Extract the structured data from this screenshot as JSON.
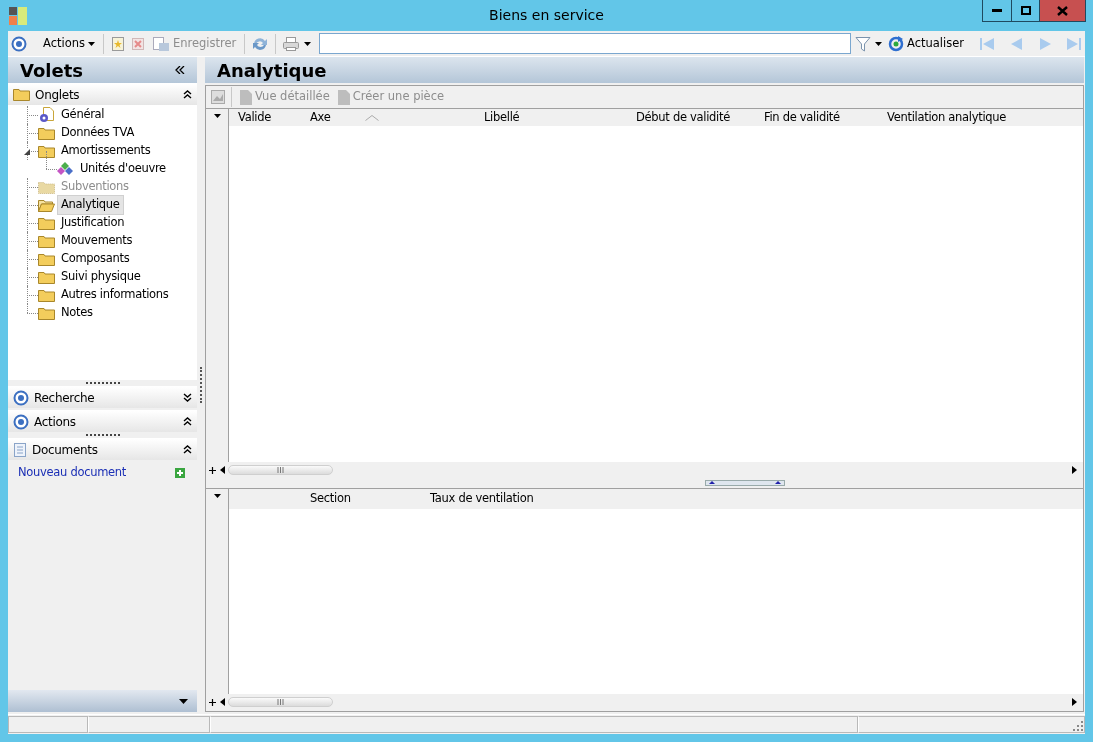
{
  "window": {
    "title": "Biens en service"
  },
  "toolbar": {
    "actions_menu": {
      "label": "Actions"
    },
    "save": {
      "label": "Enregistrer",
      "disabled": true
    },
    "refresh": {
      "label": "Actualiser",
      "disabled": false
    }
  },
  "sidebar": {
    "title": "Volets",
    "sections": [
      {
        "kind": "tree",
        "title": "Onglets",
        "expanded": true,
        "items": [
          {
            "kind": "page",
            "label": "Général",
            "selected": false,
            "disabled": false
          },
          {
            "kind": "folder",
            "label": "Données TVA",
            "selected": false,
            "disabled": false
          },
          {
            "kind": "folder",
            "label": "Amortissements",
            "selected": false,
            "disabled": false,
            "expanded": true,
            "children": [
              {
                "kind": "component",
                "label": "Unités d'oeuvre",
                "selected": false,
                "disabled": false
              }
            ]
          },
          {
            "kind": "folder",
            "label": "Subventions",
            "selected": false,
            "disabled": true
          },
          {
            "kind": "folder",
            "label": "Analytique",
            "selected": true,
            "disabled": false
          },
          {
            "kind": "folder",
            "label": "Justification",
            "selected": false,
            "disabled": false
          },
          {
            "kind": "folder",
            "label": "Mouvements",
            "selected": false,
            "disabled": false
          },
          {
            "kind": "folder",
            "label": "Composants",
            "selected": false,
            "disabled": false
          },
          {
            "kind": "folder",
            "label": "Suivi physique",
            "selected": false,
            "disabled": false
          },
          {
            "kind": "folder",
            "label": "Autres informations",
            "selected": false,
            "disabled": false
          },
          {
            "kind": "folder",
            "label": "Notes",
            "selected": false,
            "disabled": false
          }
        ]
      },
      {
        "kind": "task",
        "title": "Recherche",
        "expanded": false
      },
      {
        "kind": "task",
        "title": "Actions",
        "expanded": true
      },
      {
        "kind": "links",
        "title": "Documents",
        "expanded": true,
        "links": [
          "Nouveau document"
        ]
      }
    ]
  },
  "main": {
    "title": "Analytique",
    "subtoolbar": {
      "detail_view": {
        "label": "Vue détaillée",
        "disabled": true
      },
      "create_piece": {
        "label": "Créer une pièce",
        "disabled": true
      }
    },
    "grid": {
      "columns": [
        {
          "label": "Valide",
          "sorted": false
        },
        {
          "label": "Axe",
          "sorted": false
        },
        {
          "sorted": true
        },
        {
          "label": "Libellé",
          "sorted": false
        },
        {
          "label": "Début de validité",
          "sorted": false
        },
        {
          "label": "Fin de validité",
          "sorted": false
        },
        {
          "label": "Ventilation analytique",
          "sorted": false
        }
      ]
    },
    "detail_grid": {
      "columns": [
        {
          "label": "Section"
        },
        {
          "label": "Taux de ventilation"
        }
      ]
    }
  }
}
